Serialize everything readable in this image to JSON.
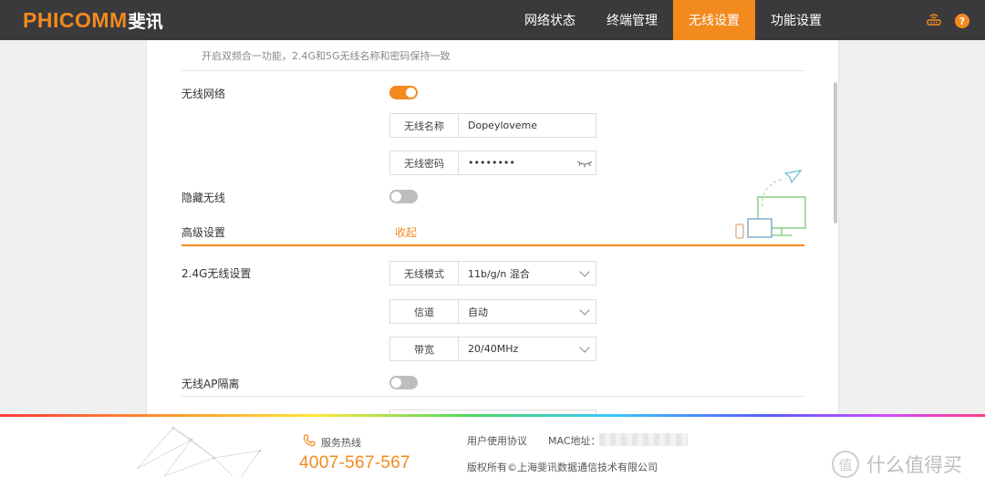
{
  "header": {
    "brand_en": "PHICOMM",
    "brand_cn": "斐讯",
    "tabs": [
      {
        "label": "网络状态",
        "active": false
      },
      {
        "label": "终端管理",
        "active": false
      },
      {
        "label": "无线设置",
        "active": true
      },
      {
        "label": "功能设置",
        "active": false
      }
    ],
    "icons": [
      "router-icon",
      "help-icon"
    ],
    "help_glyph": "?"
  },
  "colors": {
    "accent": "#f28a1e",
    "header_bg": "#3a3a3c"
  },
  "wireless": {
    "dual_band_note": "开启双频合一功能，2.4G和5G无线名称和密码保持一致",
    "network_label": "无线网络",
    "network_enabled": true,
    "ssid_label": "无线名称",
    "ssid_value": "Dopeyloveme",
    "password_label": "无线密码",
    "password_value": "••••••••",
    "hide_label": "隐藏无线",
    "hide_enabled": false,
    "advanced_label": "高级设置",
    "collapse_label": "收起",
    "band24_label": "2.4G无线设置",
    "mode_label": "无线模式",
    "mode_value": "11b/g/n 混合",
    "channel_label": "信道",
    "channel_value": "自动",
    "bandwidth_label": "带宽",
    "bandwidth_value": "20/40MHz",
    "ap_isolation_label": "无线AP隔离",
    "ap_isolation_enabled": false
  },
  "footer": {
    "hotline_label": "服务热线",
    "hotline_number": "4007-567-567",
    "user_agreement": "用户使用协议",
    "mac_label": "MAC地址：",
    "copyright": "版权所有©上海斐讯数据通信技术有限公司",
    "watermark_text": "什么值得买",
    "watermark_logo": "值"
  }
}
